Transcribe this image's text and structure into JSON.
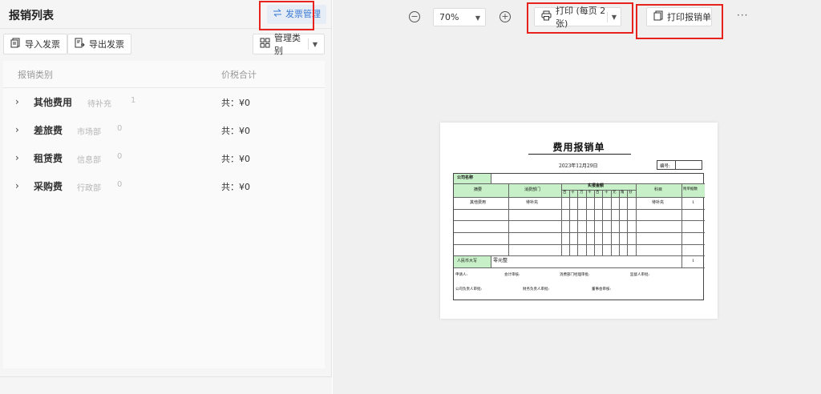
{
  "left_panel": {
    "title": "报销列表",
    "invoice_mgmt": "发票管理",
    "import_btn": "导入发票",
    "export_btn": "导出发票",
    "category_btn": "管理类别",
    "columns": {
      "category": "报销类别",
      "total": "价税合计"
    },
    "rows": [
      {
        "name": "其他费用",
        "dept": "待补充",
        "count": "1",
        "total": "共：¥0"
      },
      {
        "name": "差旅费",
        "dept": "市场部",
        "count": "0",
        "total": "共：¥0"
      },
      {
        "name": "租赁费",
        "dept": "信息部",
        "count": "0",
        "total": "共：¥0"
      },
      {
        "name": "采购费",
        "dept": "行政部",
        "count": "0",
        "total": "共：¥0"
      }
    ]
  },
  "preview": {
    "zoom": "70%",
    "zoom_out": "−",
    "zoom_in": "+",
    "print_btn": "打印 (每页 2 张)",
    "print_claim_btn": "打印报销单",
    "more": "···"
  },
  "document": {
    "title": "费用报销单",
    "date": "2023年12月29日",
    "number_label": "编号:",
    "company_label": "公司名称",
    "headers": {
      "summary": "摘要",
      "dept": "消费部门",
      "amount": "实报金额",
      "subject": "科目",
      "attach": "附单据数"
    },
    "digits": [
      "百",
      "十",
      "万",
      "千",
      "百",
      "十",
      "元",
      "角",
      "分"
    ],
    "row1": {
      "summary": "其他费用",
      "dept": "待补充",
      "subject": "待补充",
      "attach": "1"
    },
    "rmb_label": "人民币大写",
    "rmb_value": "零元整",
    "total_attach": "1",
    "sign1": [
      "申请人:",
      "会计审核:",
      "消费部门经理审批:",
      "监督人审批:"
    ],
    "sign2": [
      "公司负责人审批:",
      "财务负责人审批:",
      "董事会审核:"
    ]
  },
  "colors": {
    "accent": "#3a7bd5",
    "highlight_border": "#e8231d",
    "table_header_green": "#c8f0c8"
  },
  "icons": [
    "swap-icon",
    "import-icon",
    "export-icon",
    "grid-icon",
    "printer-icon",
    "document-icon",
    "zoom-out-icon",
    "zoom-in-icon",
    "more-icon",
    "chevron-right-icon"
  ]
}
